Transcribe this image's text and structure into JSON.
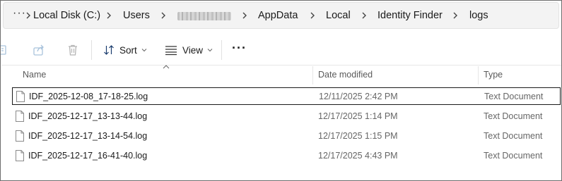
{
  "addressbar": {
    "overflow_icon": "ellipsis-icon",
    "crumbs": [
      "Local Disk (C:)",
      "Users",
      "AppData",
      "Local",
      "Identity Finder",
      "logs"
    ]
  },
  "toolbar": {
    "sort_label": "Sort",
    "view_label": "View",
    "more_label": "···"
  },
  "columns": {
    "name": "Name",
    "date": "Date modified",
    "type": "Type"
  },
  "files": [
    {
      "name": "IDF_2025-12-08_17-18-25.log",
      "date": "12/11/2025 2:42 PM",
      "type": "Text Document"
    },
    {
      "name": "IDF_2025-12-17_13-13-44.log",
      "date": "12/17/2025 1:14 PM",
      "type": "Text Document"
    },
    {
      "name": "IDF_2025-12-17_13-14-54.log",
      "date": "12/17/2025 1:15 PM",
      "type": "Text Document"
    },
    {
      "name": "IDF_2025-12-17_16-41-40.log",
      "date": "12/17/2025 4:43 PM",
      "type": "Text Document"
    }
  ]
}
